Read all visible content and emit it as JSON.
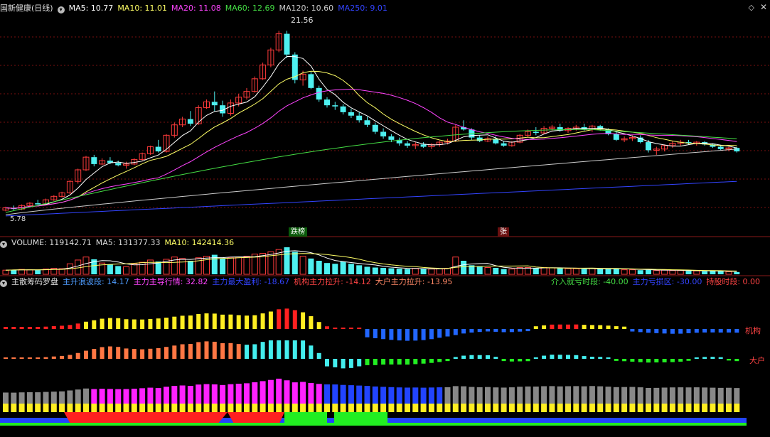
{
  "header": {
    "stock_name": "国新健康(日线)",
    "ma5": "MA5: 10.77",
    "ma10": "MA10: 11.01",
    "ma20": "MA20: 11.08",
    "ma60": "MA60: 12.69",
    "ma120": "MA120: 10.60",
    "ma250": "MA250: 9.01"
  },
  "volume_header": {
    "volume": "VOLUME: 119142.71",
    "ma5": "MA5: 131377.33",
    "ma10": "MA10: 142414.36"
  },
  "indicator_header": {
    "name": "主散筹码罗盘",
    "wave": "主升浪波段: 14.17",
    "trend": "主力主导行情: 32.82",
    "profit": "主力最大盈利: -18.67",
    "inst_pull": "机构主力拉升: -14.12",
    "big_pull": "大户主力拉升: -13.95",
    "loss_time": "介入就亏时段: -40.00",
    "trap": "主力亏损区: -30.00",
    "hold": "持股时段: 0.00"
  },
  "labels": {
    "peak": "21.56",
    "low": "5.78",
    "badge_drop": "跌榜",
    "badge_up": "张",
    "inst": "机构",
    "big": "大户"
  },
  "colors": {
    "up": "#ff3b3b",
    "down": "#4ef0f0",
    "ma5": "#ffffff",
    "ma10": "#ffff66",
    "ma20": "#ff44ff",
    "ma60": "#44dd44",
    "ma120": "#cccccc",
    "ma250": "#3344ff"
  },
  "chart_data": {
    "type": "candlestick",
    "price_range": [
      5.0,
      23.0
    ],
    "candles": [
      [
        6.0,
        6.3,
        5.9,
        6.2
      ],
      [
        6.2,
        6.4,
        6.0,
        6.1
      ],
      [
        6.1,
        6.5,
        6.0,
        6.4
      ],
      [
        6.4,
        6.7,
        6.3,
        6.6
      ],
      [
        6.6,
        6.9,
        6.5,
        6.5
      ],
      [
        6.5,
        7.0,
        6.4,
        6.9
      ],
      [
        6.9,
        7.3,
        6.8,
        7.2
      ],
      [
        7.2,
        7.6,
        7.1,
        7.5
      ],
      [
        7.5,
        8.6,
        7.4,
        8.5
      ],
      [
        8.5,
        9.6,
        8.3,
        9.5
      ],
      [
        9.5,
        10.7,
        9.4,
        10.6
      ],
      [
        10.6,
        10.8,
        9.8,
        10.0
      ],
      [
        10.0,
        10.5,
        9.9,
        10.3
      ],
      [
        10.3,
        10.6,
        10.0,
        10.1
      ],
      [
        10.1,
        10.3,
        9.8,
        9.9
      ],
      [
        9.9,
        10.2,
        9.6,
        10.0
      ],
      [
        10.0,
        10.5,
        9.9,
        10.4
      ],
      [
        10.4,
        11.0,
        10.3,
        10.9
      ],
      [
        10.9,
        11.6,
        10.8,
        11.5
      ],
      [
        11.5,
        12.1,
        11.0,
        11.1
      ],
      [
        11.1,
        12.6,
        11.0,
        12.5
      ],
      [
        12.5,
        13.6,
        12.3,
        13.4
      ],
      [
        13.4,
        14.1,
        13.2,
        13.9
      ],
      [
        13.9,
        14.6,
        13.3,
        13.5
      ],
      [
        13.5,
        15.1,
        13.4,
        14.9
      ],
      [
        14.9,
        15.6,
        14.8,
        15.4
      ],
      [
        15.4,
        16.3,
        14.6,
        15.1
      ],
      [
        15.1,
        15.5,
        14.1,
        14.4
      ],
      [
        14.4,
        15.6,
        14.2,
        15.3
      ],
      [
        15.3,
        16.1,
        15.0,
        15.8
      ],
      [
        15.8,
        16.6,
        15.6,
        16.3
      ],
      [
        16.3,
        17.6,
        16.2,
        17.4
      ],
      [
        17.4,
        18.8,
        17.3,
        18.6
      ],
      [
        18.6,
        20.1,
        18.4,
        19.9
      ],
      [
        19.9,
        21.56,
        19.7,
        21.3
      ],
      [
        21.3,
        21.56,
        19.2,
        19.5
      ],
      [
        19.5,
        19.7,
        17.0,
        17.3
      ],
      [
        17.3,
        18.1,
        16.8,
        17.8
      ],
      [
        17.8,
        18.0,
        16.5,
        16.6
      ],
      [
        16.6,
        16.8,
        15.4,
        15.6
      ],
      [
        15.6,
        15.8,
        14.9,
        15.1
      ],
      [
        15.1,
        15.4,
        14.7,
        15.0
      ],
      [
        15.0,
        15.2,
        14.3,
        14.5
      ],
      [
        14.5,
        14.8,
        14.0,
        14.2
      ],
      [
        14.2,
        14.5,
        13.6,
        13.8
      ],
      [
        13.8,
        14.1,
        13.2,
        13.4
      ],
      [
        13.4,
        13.6,
        12.6,
        12.8
      ],
      [
        12.8,
        13.1,
        12.2,
        12.4
      ],
      [
        12.4,
        12.6,
        11.9,
        12.1
      ],
      [
        12.1,
        12.3,
        11.6,
        11.8
      ],
      [
        11.8,
        12.0,
        11.4,
        11.6
      ],
      [
        11.6,
        11.9,
        11.3,
        11.7
      ],
      [
        11.7,
        11.9,
        11.4,
        11.5
      ],
      [
        11.5,
        11.8,
        11.3,
        11.7
      ],
      [
        11.7,
        12.0,
        11.5,
        11.9
      ],
      [
        11.9,
        12.2,
        11.7,
        12.0
      ],
      [
        12.0,
        13.4,
        11.9,
        13.2
      ],
      [
        13.2,
        13.8,
        12.9,
        13.0
      ],
      [
        13.0,
        13.1,
        12.1,
        12.3
      ],
      [
        12.3,
        12.5,
        11.9,
        12.0
      ],
      [
        12.0,
        12.4,
        11.9,
        12.2
      ],
      [
        12.2,
        12.4,
        11.7,
        11.8
      ],
      [
        11.8,
        12.0,
        11.5,
        11.6
      ],
      [
        11.6,
        12.0,
        11.5,
        11.9
      ],
      [
        11.9,
        12.6,
        11.8,
        12.5
      ],
      [
        12.5,
        13.0,
        12.3,
        12.8
      ],
      [
        12.8,
        13.2,
        12.5,
        12.7
      ],
      [
        12.7,
        13.3,
        12.6,
        13.1
      ],
      [
        13.1,
        13.4,
        12.9,
        13.2
      ],
      [
        13.2,
        13.5,
        12.8,
        12.9
      ],
      [
        12.9,
        13.2,
        12.7,
        13.1
      ],
      [
        13.1,
        13.4,
        12.9,
        13.2
      ],
      [
        13.2,
        13.5,
        12.9,
        13.0
      ],
      [
        13.0,
        13.4,
        12.8,
        13.3
      ],
      [
        13.3,
        13.4,
        12.9,
        13.0
      ],
      [
        13.0,
        13.1,
        12.5,
        12.6
      ],
      [
        12.6,
        12.8,
        12.0,
        12.1
      ],
      [
        12.1,
        12.4,
        11.9,
        12.2
      ],
      [
        12.2,
        12.5,
        12.0,
        12.3
      ],
      [
        12.3,
        12.5,
        11.8,
        11.9
      ],
      [
        11.9,
        12.1,
        11.0,
        11.2
      ],
      [
        11.2,
        11.5,
        10.8,
        11.3
      ],
      [
        11.3,
        11.7,
        11.1,
        11.6
      ],
      [
        11.6,
        12.0,
        11.4,
        11.8
      ],
      [
        11.8,
        12.1,
        11.6,
        11.9
      ],
      [
        11.9,
        12.1,
        11.7,
        11.8
      ],
      [
        11.8,
        12.0,
        11.6,
        11.9
      ],
      [
        11.9,
        12.0,
        11.6,
        11.7
      ],
      [
        11.7,
        11.8,
        11.4,
        11.5
      ],
      [
        11.5,
        11.6,
        11.2,
        11.3
      ],
      [
        11.3,
        11.5,
        11.1,
        11.4
      ],
      [
        11.4,
        11.5,
        11.0,
        11.1
      ]
    ],
    "volume": [
      [
        0.55,
        1
      ],
      [
        0.6,
        0
      ],
      [
        0.65,
        1
      ],
      [
        0.6,
        1
      ],
      [
        0.55,
        0
      ],
      [
        0.7,
        1
      ],
      [
        0.8,
        1
      ],
      [
        0.75,
        1
      ],
      [
        1.4,
        1
      ],
      [
        1.9,
        1
      ],
      [
        2.3,
        1
      ],
      [
        2.0,
        0
      ],
      [
        1.5,
        1
      ],
      [
        1.3,
        0
      ],
      [
        1.1,
        0
      ],
      [
        1.0,
        1
      ],
      [
        1.4,
        1
      ],
      [
        1.6,
        1
      ],
      [
        1.9,
        1
      ],
      [
        1.7,
        0
      ],
      [
        2.0,
        1
      ],
      [
        2.3,
        1
      ],
      [
        2.1,
        1
      ],
      [
        1.8,
        0
      ],
      [
        2.2,
        1
      ],
      [
        2.4,
        1
      ],
      [
        2.6,
        0
      ],
      [
        2.1,
        0
      ],
      [
        2.2,
        1
      ],
      [
        2.3,
        1
      ],
      [
        2.4,
        1
      ],
      [
        2.7,
        1
      ],
      [
        2.8,
        1
      ],
      [
        3.0,
        1
      ],
      [
        3.3,
        1
      ],
      [
        3.6,
        0
      ],
      [
        3.0,
        0
      ],
      [
        2.4,
        1
      ],
      [
        2.1,
        0
      ],
      [
        1.8,
        0
      ],
      [
        1.5,
        0
      ],
      [
        1.4,
        0
      ],
      [
        1.7,
        0
      ],
      [
        1.4,
        0
      ],
      [
        1.2,
        0
      ],
      [
        1.0,
        0
      ],
      [
        0.9,
        0
      ],
      [
        0.85,
        0
      ],
      [
        0.8,
        0
      ],
      [
        0.75,
        0
      ],
      [
        0.7,
        0
      ],
      [
        0.8,
        1
      ],
      [
        0.7,
        0
      ],
      [
        0.7,
        1
      ],
      [
        0.75,
        1
      ],
      [
        0.8,
        1
      ],
      [
        2.3,
        1
      ],
      [
        1.8,
        0
      ],
      [
        1.2,
        0
      ],
      [
        1.0,
        0
      ],
      [
        0.9,
        1
      ],
      [
        0.85,
        0
      ],
      [
        0.7,
        0
      ],
      [
        0.7,
        1
      ],
      [
        0.9,
        1
      ],
      [
        0.9,
        1
      ],
      [
        0.85,
        0
      ],
      [
        0.9,
        1
      ],
      [
        0.85,
        1
      ],
      [
        0.8,
        0
      ],
      [
        0.75,
        1
      ],
      [
        0.75,
        1
      ],
      [
        0.7,
        0
      ],
      [
        0.8,
        1
      ],
      [
        0.7,
        0
      ],
      [
        0.7,
        0
      ],
      [
        0.8,
        0
      ],
      [
        0.6,
        1
      ],
      [
        0.6,
        1
      ],
      [
        0.55,
        0
      ],
      [
        0.6,
        0
      ],
      [
        0.5,
        1
      ],
      [
        0.55,
        1
      ],
      [
        0.5,
        1
      ],
      [
        0.5,
        1
      ],
      [
        0.45,
        0
      ],
      [
        0.45,
        1
      ],
      [
        0.4,
        0
      ],
      [
        0.45,
        0
      ],
      [
        0.4,
        0
      ],
      [
        0.35,
        1
      ],
      [
        0.3,
        0
      ]
    ]
  }
}
